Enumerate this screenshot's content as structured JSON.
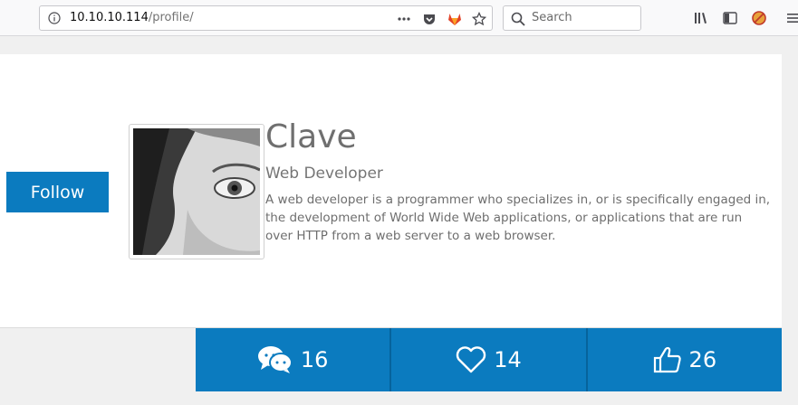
{
  "browser": {
    "url_host": "10.10.10.114",
    "url_path": "/profile/",
    "search_placeholder": "Search"
  },
  "profile": {
    "follow_label": "Follow",
    "name": "Clave",
    "role": "Web Developer",
    "bio": "A web developer is a programmer who specializes in, or is specifically engaged in, the development of World Wide Web applications, or applications that are run over HTTP from a web server to a web browser."
  },
  "stats": [
    {
      "icon": "chat-icon",
      "count": "16"
    },
    {
      "icon": "heart-icon",
      "count": "14"
    },
    {
      "icon": "thumbs-up-icon",
      "count": "26"
    }
  ],
  "colors": {
    "accent": "#0b7bbf",
    "divider": "#06639c"
  }
}
